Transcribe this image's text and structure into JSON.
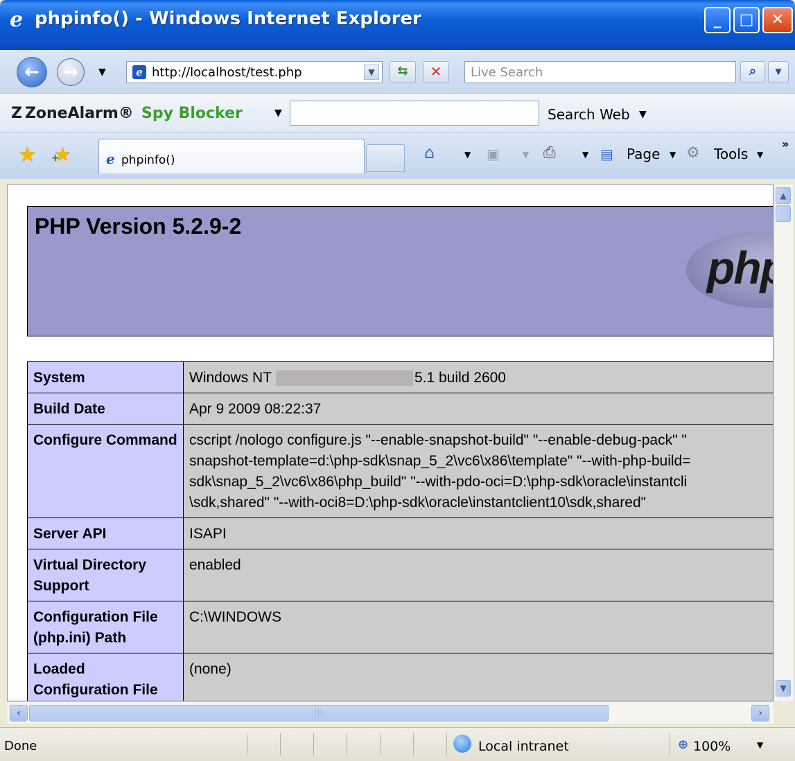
{
  "window": {
    "title": "phpinfo() - Windows Internet Explorer",
    "icon": "ie-logo-icon"
  },
  "nav": {
    "url": "http://localhost/test.php",
    "search_placeholder": "Live Search"
  },
  "zonealarm": {
    "brand": "ZoneAlarm®",
    "product": "Spy Blocker",
    "search_web_label": "Search Web"
  },
  "tabs": [
    {
      "label": "phpinfo()"
    }
  ],
  "command_bar": {
    "page_label": "Page",
    "tools_label": "Tools"
  },
  "page": {
    "heading": "PHP Version 5.2.9-2",
    "logo_text": "php",
    "rows": [
      {
        "key": "System",
        "value_before": "Windows NT",
        "value_after": "5.1 build 2600",
        "redacted": true
      },
      {
        "key": "Build Date",
        "value": "Apr 9 2009 08:22:37"
      },
      {
        "key": "Configure Command",
        "lines": [
          "cscript /nologo configure.js \"--enable-snapshot-build\" \"--enable-debug-pack\" \"",
          "snapshot-template=d:\\php-sdk\\snap_5_2\\vc6\\x86\\template\" \"--with-php-build=",
          "sdk\\snap_5_2\\vc6\\x86\\php_build\" \"--with-pdo-oci=D:\\php-sdk\\oracle\\instantcli",
          "\\sdk,shared\" \"--with-oci8=D:\\php-sdk\\oracle\\instantclient10\\sdk,shared\""
        ]
      },
      {
        "key": "Server API",
        "value": "ISAPI"
      },
      {
        "key": "Virtual Directory Support",
        "value": "enabled"
      },
      {
        "key": "Configuration File (php.ini) Path",
        "value": "C:\\WINDOWS"
      },
      {
        "key": "Loaded Configuration File",
        "value": "(none)"
      }
    ]
  },
  "status": {
    "text": "Done",
    "zone": "Local intranet",
    "zoom": "100%"
  },
  "colors": {
    "title_bar": "#0a5fd8",
    "php_header": "#9999cc",
    "php_key_cell": "#ccccff",
    "php_value_cell": "#cccccc"
  }
}
